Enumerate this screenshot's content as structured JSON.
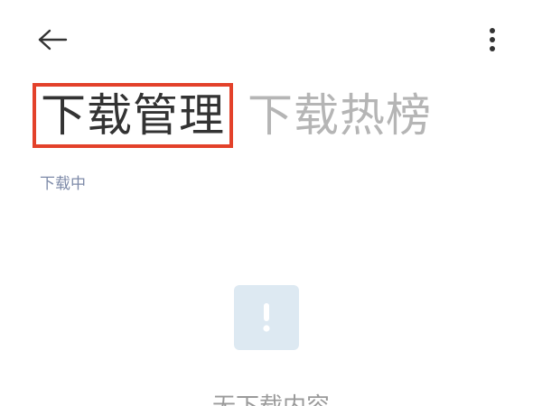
{
  "header": {
    "back_icon": "arrow-left-icon",
    "more_icon": "more-vertical-icon"
  },
  "tabs": [
    {
      "label": "下载管理",
      "active": true
    },
    {
      "label": "下载热榜",
      "active": false
    }
  ],
  "section": {
    "label": "下载中"
  },
  "empty_state": {
    "icon": "exclamation-icon",
    "text": "无下载内容"
  },
  "colors": {
    "highlight_border": "#e3412a",
    "active_tab_text": "#333333",
    "inactive_tab_text": "#b5b5b5",
    "section_label": "#7d8aa8",
    "empty_icon_bg": "#dde9f2"
  }
}
